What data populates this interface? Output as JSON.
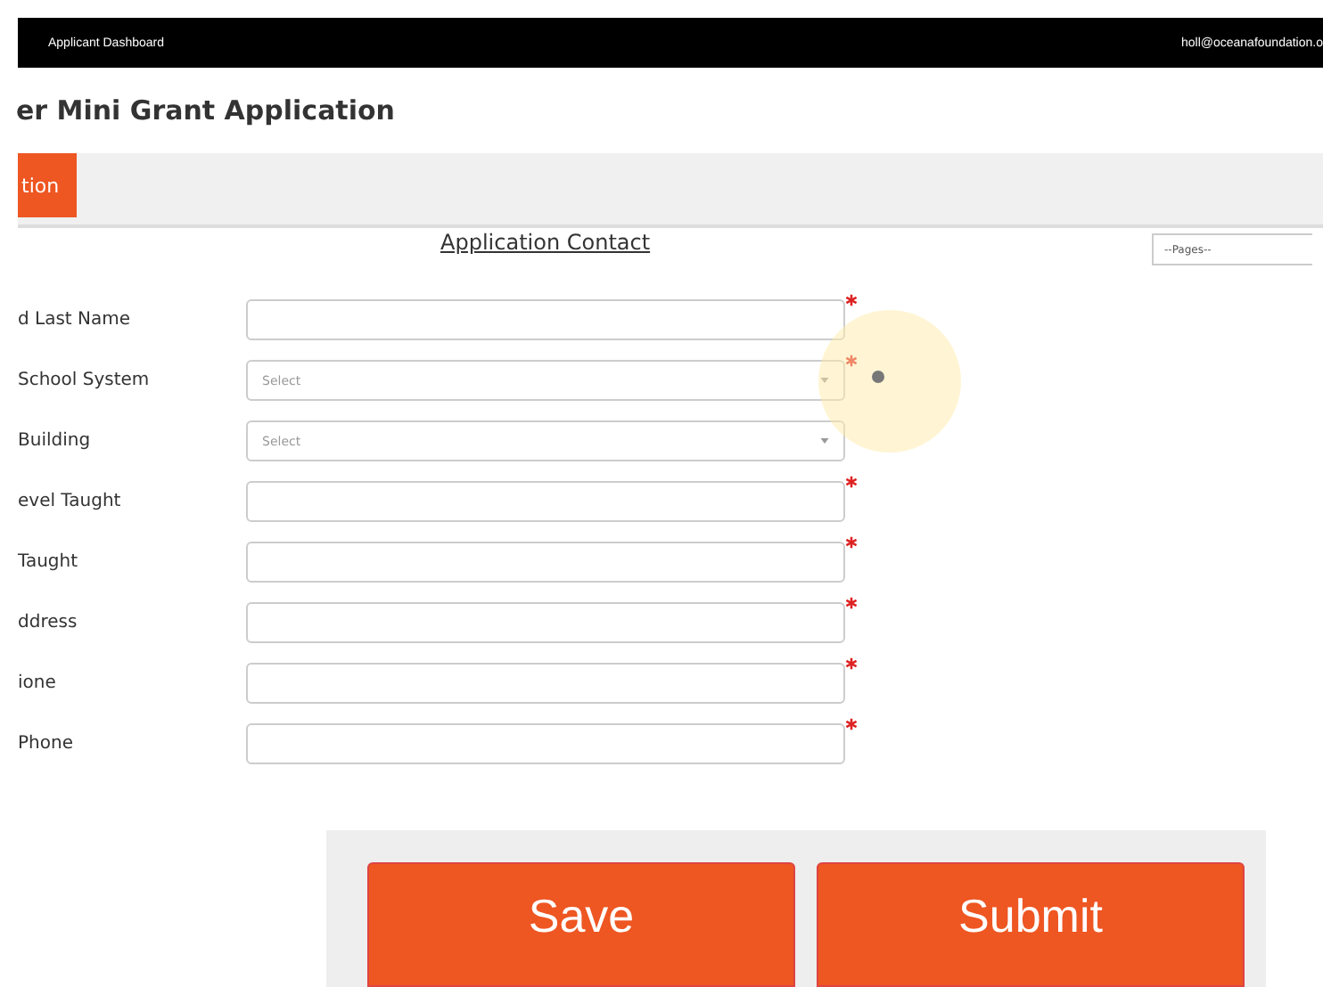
{
  "top_bar": {
    "title": "Applicant Dashboard",
    "user": "holl@oceanafoundation.o"
  },
  "page_title": "er Mini Grant Application",
  "tabs": [
    {
      "label": "tion",
      "selected": true
    }
  ],
  "section_title": "Application Contact",
  "pages_select": {
    "value": "--Pages--"
  },
  "fields": [
    {
      "label": "d Last Name",
      "kind": "text",
      "required": true,
      "help": false
    },
    {
      "label": "School System",
      "kind": "select",
      "placeholder": "Select",
      "required": true,
      "help": true
    },
    {
      "label": "Building",
      "kind": "select",
      "placeholder": "Select",
      "required": false,
      "help": false
    },
    {
      "label": "evel Taught",
      "kind": "text",
      "required": true,
      "help": false
    },
    {
      "label": "Taught",
      "kind": "text",
      "required": true,
      "help": false
    },
    {
      "label": "ddress",
      "kind": "text",
      "required": true,
      "help": false
    },
    {
      "label": "ione",
      "kind": "text",
      "required": true,
      "help": false
    },
    {
      "label": "Phone",
      "kind": "text",
      "required": true,
      "help": false
    }
  ],
  "buttons": [
    "Save",
    "Submit"
  ]
}
